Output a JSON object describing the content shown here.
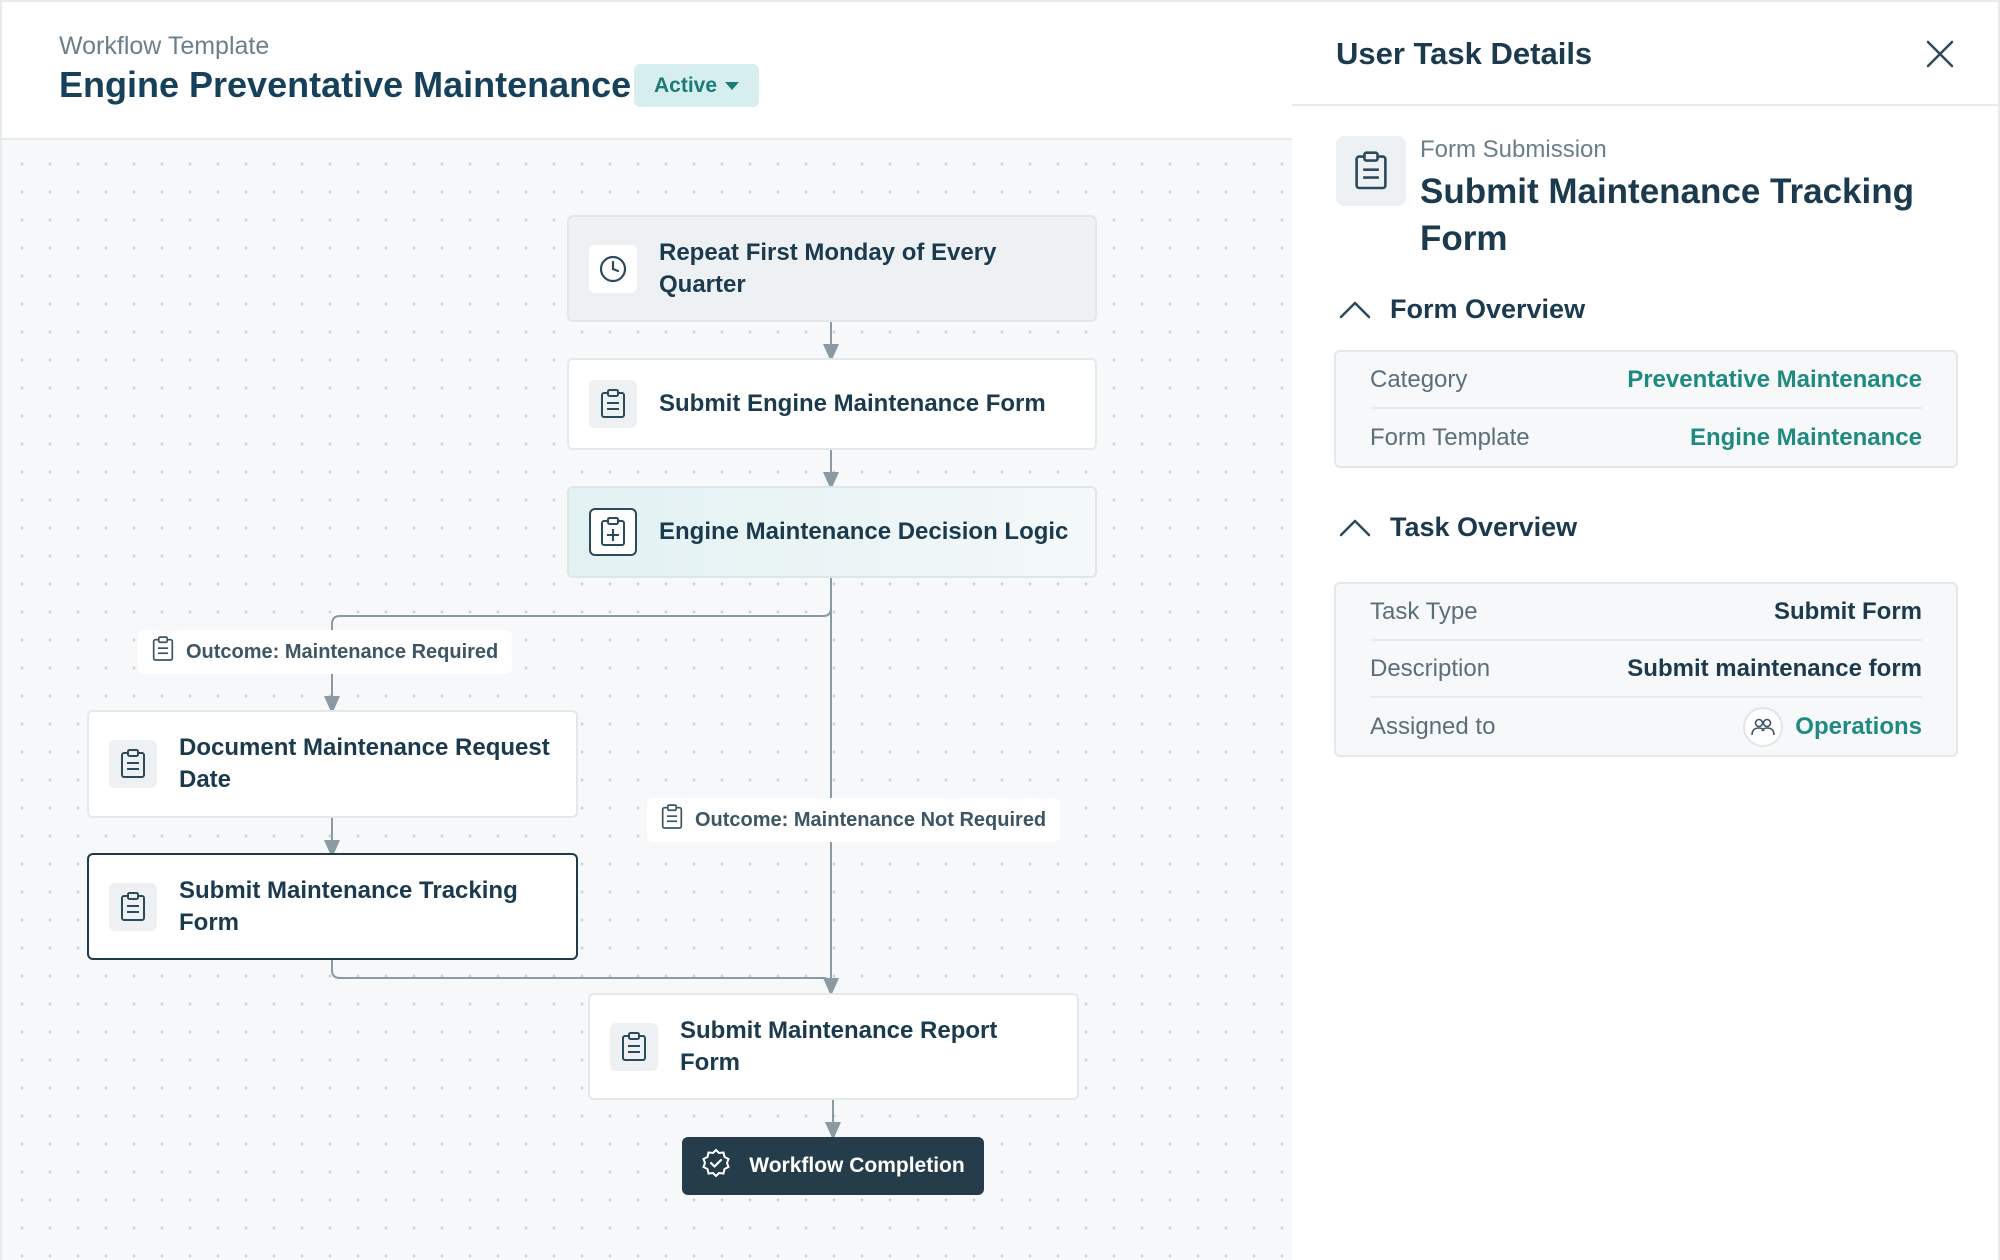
{
  "header": {
    "label": "Workflow Template",
    "title": "Engine Preventative Maintenance",
    "status": "Active"
  },
  "workflow": {
    "trigger": {
      "label": "Repeat First Monday of Every Quarter",
      "icon": "clock-icon"
    },
    "step_submit_engine_form": {
      "label": "Submit Engine Maintenance Form",
      "icon": "clipboard-icon"
    },
    "decision": {
      "label": "Engine Maintenance Decision Logic",
      "icon": "clipboard-plus-icon"
    },
    "outcome_required": {
      "label": "Outcome: Maintenance Required",
      "icon": "clipboard-icon"
    },
    "outcome_not_required": {
      "label": "Outcome: Maintenance Not Required",
      "icon": "clipboard-icon"
    },
    "step_document_request": {
      "label": "Document Maintenance Request Date",
      "icon": "clipboard-icon"
    },
    "step_tracking_form": {
      "label": "Submit Maintenance Tracking Form",
      "icon": "clipboard-icon"
    },
    "step_report_form": {
      "label": "Submit Maintenance Report Form",
      "icon": "clipboard-icon"
    },
    "completion": {
      "label": "Workflow Completion",
      "icon": "badge-check-icon"
    }
  },
  "panel": {
    "title": "User Task Details",
    "task_kind": "Form Submission",
    "task_name": "Submit Maintenance Tracking Form",
    "form_overview": {
      "heading": "Form Overview",
      "rows": [
        {
          "key": "Category",
          "value": "Preventative Maintenance"
        },
        {
          "key": "Form Template",
          "value": "Engine Maintenance"
        }
      ]
    },
    "task_overview": {
      "heading": "Task Overview",
      "rows": [
        {
          "key": "Task Type",
          "value": "Submit Form"
        },
        {
          "key": "Description",
          "value": "Submit maintenance form"
        },
        {
          "key": "Assigned to",
          "value": "Operations",
          "icon": "users-icon"
        }
      ]
    }
  },
  "colors": {
    "accent": "#1f8a82",
    "badge_bg": "#d7eeee",
    "dark": "#253d4b",
    "text": "#1b3a4e"
  }
}
